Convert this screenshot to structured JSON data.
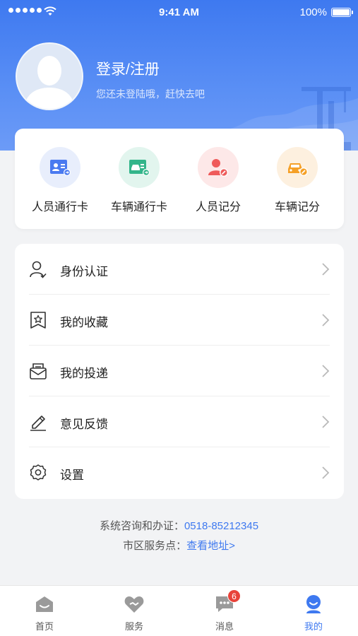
{
  "status_bar": {
    "time": "9:41 AM",
    "battery": "100%"
  },
  "profile": {
    "title": "登录/注册",
    "subtitle": "您还未登陆哦，赶快去吧"
  },
  "quick_actions": [
    {
      "label": "人员通行卡",
      "icon": "person-card-icon",
      "color": "#4a7af0"
    },
    {
      "label": "车辆通行卡",
      "icon": "vehicle-card-icon",
      "color": "#33b58a"
    },
    {
      "label": "人员记分",
      "icon": "person-score-icon",
      "color": "#ef5b5b"
    },
    {
      "label": "车辆记分",
      "icon": "vehicle-score-icon",
      "color": "#f5a027"
    }
  ],
  "menu": [
    {
      "label": "身份认证",
      "icon": "identity-icon"
    },
    {
      "label": "我的收藏",
      "icon": "favorites-icon"
    },
    {
      "label": "我的投递",
      "icon": "delivery-icon"
    },
    {
      "label": "意见反馈",
      "icon": "feedback-icon"
    },
    {
      "label": "设置",
      "icon": "settings-icon"
    }
  ],
  "contact": {
    "hotline_label": "系统咨询和办证：",
    "hotline_number": "0518-85212345",
    "office_label": "市区服务点：",
    "office_link": "查看地址>"
  },
  "tabs": [
    {
      "label": "首页",
      "icon": "home-icon",
      "active": false
    },
    {
      "label": "服务",
      "icon": "service-icon",
      "active": false
    },
    {
      "label": "消息",
      "icon": "message-icon",
      "active": false,
      "badge": "6"
    },
    {
      "label": "我的",
      "icon": "profile-icon",
      "active": true
    }
  ],
  "colors": {
    "primary": "#3e79f0",
    "badge": "#e8433a"
  }
}
